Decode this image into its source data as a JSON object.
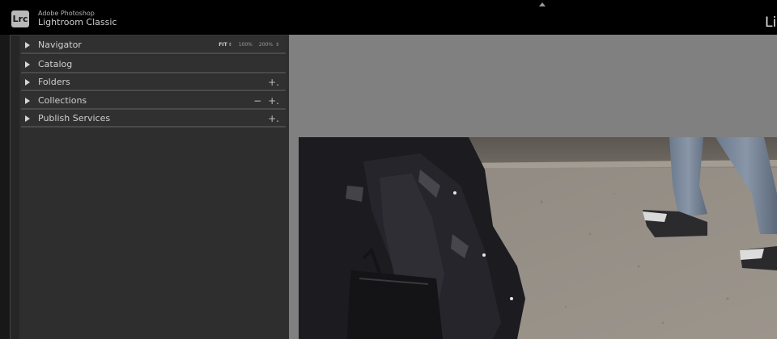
{
  "app": {
    "brand_line1": "Adobe Photoshop",
    "brand_line2": "Lightroom Classic",
    "logo_text": "Lrc",
    "module_peek": "Li"
  },
  "left_panel": {
    "navigator": {
      "label": "Navigator",
      "zoom_options": [
        "FIT",
        "100%",
        "200%"
      ]
    },
    "sections": [
      {
        "label": "Catalog"
      },
      {
        "label": "Folders",
        "action": "+."
      },
      {
        "label": "Collections",
        "action_minus": "−",
        "action": "+."
      },
      {
        "label": "Publish Services",
        "action": "+."
      }
    ]
  },
  "main": {
    "photo_description_icon": "street-photo"
  },
  "colors": {
    "top_bar": "#000000",
    "panel_bg": "#2e2e2e",
    "main_bg": "#808080",
    "text": "#cfcfcf"
  }
}
